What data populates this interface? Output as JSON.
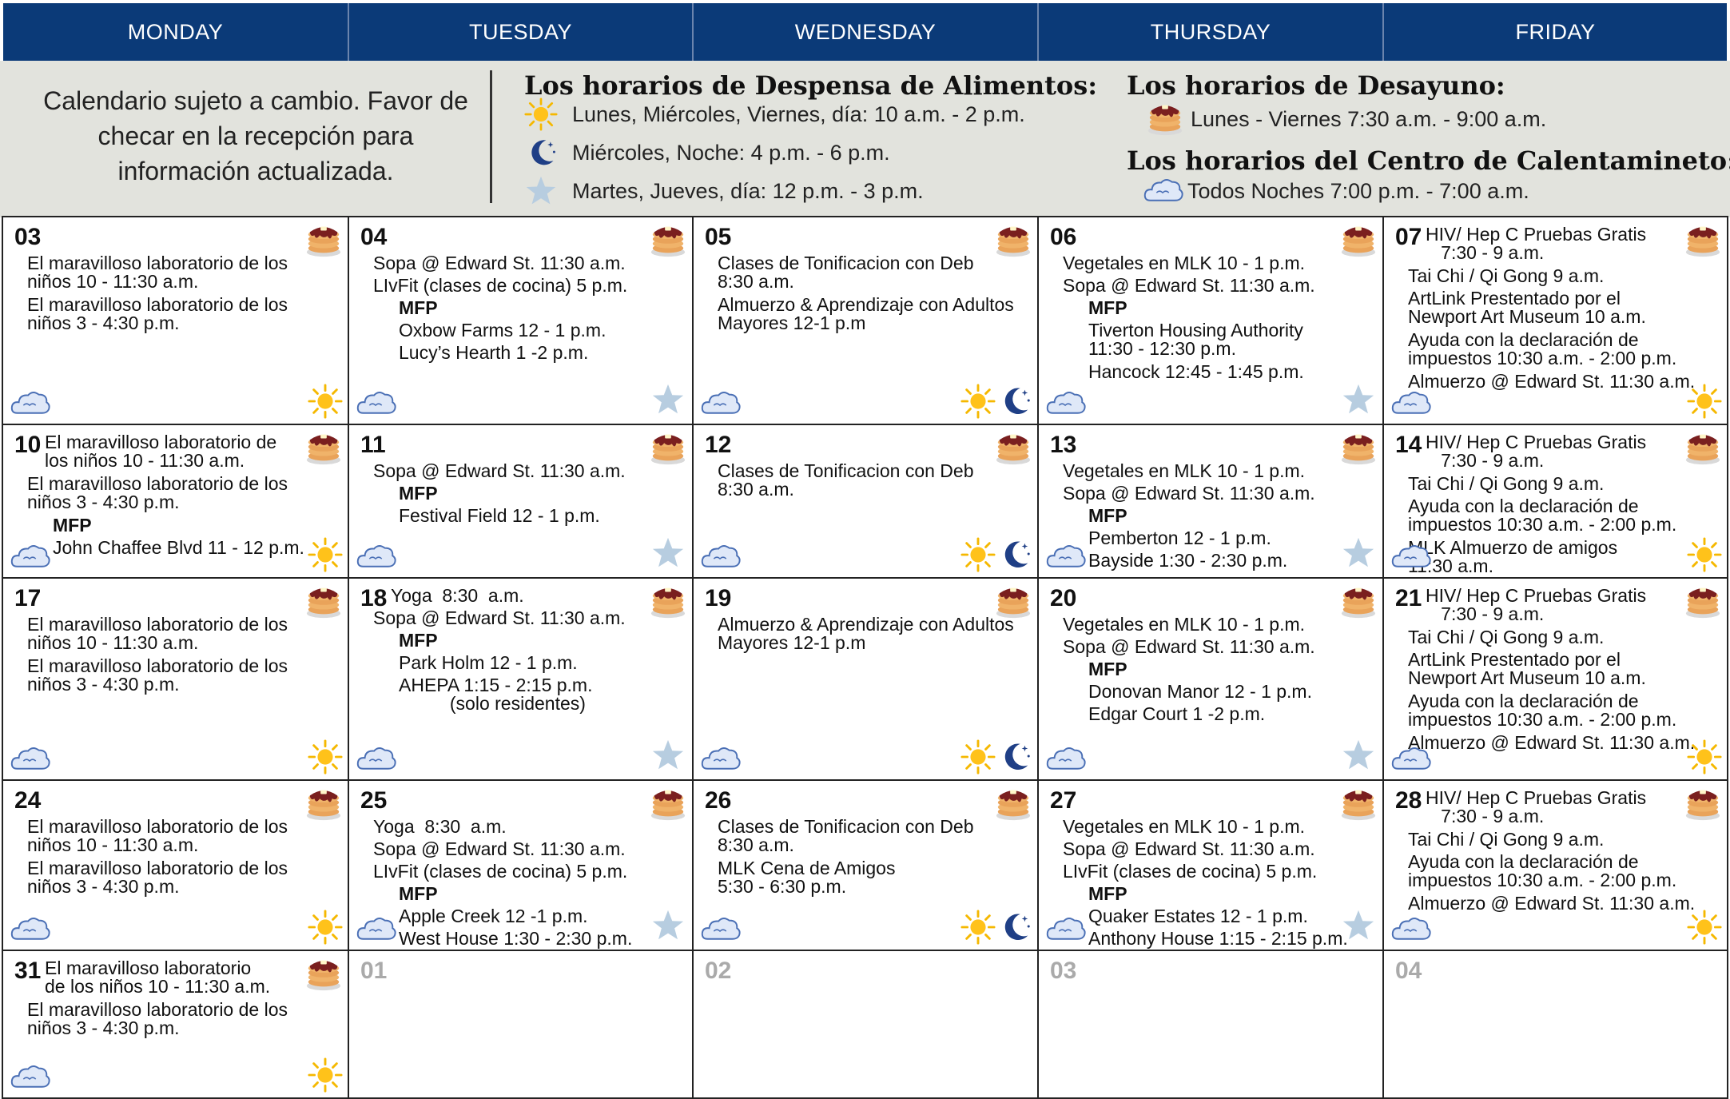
{
  "days": [
    "MONDAY",
    "TUESDAY",
    "WEDNESDAY",
    "THURSDAY",
    "FRIDAY"
  ],
  "notice": "Calendario sujeto a  cambio. Favor de checar en la recepción para información actualizada.",
  "pantry": {
    "title": "Los horarios de Despensa de Alimentos:",
    "lines": [
      {
        "icon": "sun-icon",
        "text": "Lunes, Miércoles, Viernes, día: 10 a.m. - 2 p.m."
      },
      {
        "icon": "moon-icon",
        "text": "Miércoles, Noche: 4 p.m. - 6 p.m."
      },
      {
        "icon": "star-icon",
        "text": "Martes, Jueves, día: 12 p.m. - 3 p.m."
      }
    ]
  },
  "breakfast": {
    "title": "Los horarios de Desayuno:",
    "icon": "pancake-icon",
    "text": "Lunes - Viernes 7:30 a.m. - 9:00 a.m."
  },
  "warming": {
    "title": "Los horarios del Centro de Calentamineto:",
    "icon": "cloud-icon",
    "text": "Todos Noches  7:00 p.m. - 7:00 a.m."
  },
  "cells": [
    {
      "date": "03",
      "icons": [
        "pancake",
        "cloud",
        "sun"
      ],
      "events": [
        {
          "text": "El maravilloso laboratorio de los\nniños 10 - 11:30 a.m."
        },
        {
          "text": "El maravilloso laboratorio de los\nniños 3 - 4:30 p.m."
        }
      ]
    },
    {
      "date": "04",
      "icons": [
        "pancake",
        "cloud",
        "star"
      ],
      "events": [
        {
          "text": "Sopa @ Edward St. 11:30 a.m."
        },
        {
          "text": "LIvFit (clases de cocina) 5 p.m."
        },
        {
          "text": "MFP",
          "bold": true
        },
        {
          "text": "Oxbow Farms 12 - 1 p.m."
        },
        {
          "text": "Lucy’s Hearth 1 -2 p.m."
        }
      ]
    },
    {
      "date": "05",
      "icons": [
        "pancake",
        "cloud",
        "sun",
        "moon"
      ],
      "events": [
        {
          "text": "Clases de Tonificacion con Deb\n8:30 a.m."
        },
        {
          "text": "Almuerzo & Aprendizaje con Adultos\nMayores 12-1 p.m"
        }
      ]
    },
    {
      "date": "06",
      "icons": [
        "pancake",
        "cloud",
        "star"
      ],
      "events": [
        {
          "text": "Vegetales en MLK 10 - 1 p.m."
        },
        {
          "text": "Sopa @ Edward St. 11:30 a.m."
        },
        {
          "text": "MFP",
          "bold": true
        },
        {
          "text": "Tiverton Housing Authority\n11:30 - 12:30 p.m."
        },
        {
          "text": "Hancock 12:45 - 1:45 p.m."
        }
      ]
    },
    {
      "date": "07",
      "icons": [
        "pancake",
        "cloud",
        "sun"
      ],
      "events": [
        {
          "text": "HIV/ Hep C Pruebas Gratis\n   7:30 - 9 a.m."
        },
        {
          "text": "Tai Chi / Qi Gong 9 a.m."
        },
        {
          "text": "ArtLink Prestentado por el\nNewport Art Museum 10 a.m."
        },
        {
          "text": "Ayuda con la declaración de\nimpuestos 10:30 a.m. - 2:00 p.m."
        },
        {
          "text": "Almuerzo @ Edward St. 11:30 a.m."
        }
      ]
    },
    {
      "date": "10",
      "icons": [
        "pancake",
        "cloud",
        "sun"
      ],
      "events": [
        {
          "text": "El maravilloso laboratorio de\nlos niños 10 - 11:30 a.m."
        },
        {
          "text": "El maravilloso laboratorio de los\nniños 3 - 4:30 p.m."
        },
        {
          "text": "MFP",
          "bold": true
        },
        {
          "text": "John Chaffee Blvd 11 - 12 p.m."
        }
      ]
    },
    {
      "date": "11",
      "icons": [
        "pancake",
        "cloud",
        "star"
      ],
      "events": [
        {
          "text": "Sopa @ Edward St. 11:30 a.m."
        },
        {
          "text": "MFP",
          "bold": true
        },
        {
          "text": "Festival Field 12 - 1 p.m."
        }
      ]
    },
    {
      "date": "12",
      "icons": [
        "pancake",
        "cloud",
        "sun",
        "moon"
      ],
      "events": [
        {
          "text": "Clases de Tonificacion con Deb\n8:30 a.m."
        }
      ]
    },
    {
      "date": "13",
      "icons": [
        "pancake",
        "cloud",
        "star"
      ],
      "events": [
        {
          "text": "Vegetales en MLK 10 - 1 p.m."
        },
        {
          "text": "Sopa @ Edward St. 11:30 a.m."
        },
        {
          "text": "MFP",
          "bold": true
        },
        {
          "text": "Pemberton 12 - 1 p.m."
        },
        {
          "text": "Bayside 1:30 - 2:30 p.m."
        }
      ]
    },
    {
      "date": "14",
      "icons": [
        "pancake",
        "cloud",
        "sun"
      ],
      "events": [
        {
          "text": "HIV/ Hep C Pruebas Gratis\n   7:30 - 9 a.m."
        },
        {
          "text": "Tai Chi / Qi Gong 9 a.m."
        },
        {
          "text": "Ayuda con la declaración de\nimpuestos 10:30 a.m. - 2:00 p.m."
        },
        {
          "text": "MLK Almuerzo de amigos\n11:30 a.m."
        }
      ]
    },
    {
      "date": "17",
      "icons": [
        "pancake",
        "cloud",
        "sun"
      ],
      "events": [
        {
          "text": "El maravilloso laboratorio de los\nniños 10 - 11:30 a.m."
        },
        {
          "text": "El maravilloso laboratorio de los\nniños 3 - 4:30 p.m."
        }
      ]
    },
    {
      "date": "18",
      "icons": [
        "pancake",
        "cloud",
        "star"
      ],
      "events": [
        {
          "text": "Yoga  8:30  a.m."
        },
        {
          "text": "Sopa @ Edward St. 11:30 a.m."
        },
        {
          "text": "MFP",
          "bold": true
        },
        {
          "text": "Park Holm 12 - 1 p.m."
        },
        {
          "text": "AHEPA 1:15 - 2:15 p.m.\n          (solo residentes)"
        }
      ]
    },
    {
      "date": "19",
      "icons": [
        "pancake",
        "cloud",
        "sun",
        "moon"
      ],
      "events": [
        {
          "text": "Almuerzo & Aprendizaje con Adultos\nMayores 12-1 p.m"
        }
      ]
    },
    {
      "date": "20",
      "icons": [
        "pancake",
        "cloud",
        "star"
      ],
      "events": [
        {
          "text": "Vegetales en MLK 10 - 1 p.m."
        },
        {
          "text": "Sopa @ Edward St. 11:30 a.m."
        },
        {
          "text": "MFP",
          "bold": true
        },
        {
          "text": "Donovan Manor 12 - 1 p.m."
        },
        {
          "text": "Edgar Court 1 -2 p.m."
        }
      ]
    },
    {
      "date": "21",
      "icons": [
        "pancake",
        "cloud",
        "sun"
      ],
      "events": [
        {
          "text": "HIV/ Hep C Pruebas Gratis\n   7:30 - 9 a.m."
        },
        {
          "text": "Tai Chi / Qi Gong 9 a.m."
        },
        {
          "text": "ArtLink Prestentado por el\nNewport Art Museum 10 a.m."
        },
        {
          "text": "Ayuda con la declaración de\nimpuestos 10:30 a.m. - 2:00 p.m."
        },
        {
          "text": "Almuerzo @ Edward St. 11:30 a.m."
        }
      ]
    },
    {
      "date": "24",
      "icons": [
        "pancake",
        "cloud",
        "sun"
      ],
      "events": [
        {
          "text": "El maravilloso laboratorio de los\nniños 10 - 11:30 a.m."
        },
        {
          "text": "El maravilloso laboratorio de los\nniños 3 - 4:30 p.m."
        }
      ]
    },
    {
      "date": "25",
      "icons": [
        "pancake",
        "cloud",
        "star"
      ],
      "events": [
        {
          "text": "Yoga  8:30  a.m."
        },
        {
          "text": "Sopa @ Edward St. 11:30 a.m."
        },
        {
          "text": "LIvFit (clases de cocina) 5 p.m."
        },
        {
          "text": "MFP",
          "bold": true
        },
        {
          "text": "Apple Creek 12 -1 p.m."
        },
        {
          "text": "West House 1:30 - 2:30 p.m."
        }
      ]
    },
    {
      "date": "26",
      "icons": [
        "pancake",
        "cloud",
        "sun",
        "moon"
      ],
      "events": [
        {
          "text": "Clases de Tonificacion con Deb\n8:30 a.m."
        },
        {
          "text": "MLK Cena de Amigos\n5:30 - 6:30 p.m."
        }
      ]
    },
    {
      "date": "27",
      "icons": [
        "pancake",
        "cloud",
        "star"
      ],
      "events": [
        {
          "text": "Vegetales en MLK 10 - 1 p.m."
        },
        {
          "text": "Sopa @ Edward St. 11:30 a.m."
        },
        {
          "text": "LIvFit (clases de cocina) 5 p.m."
        },
        {
          "text": "MFP",
          "bold": true
        },
        {
          "text": "Quaker Estates 12 - 1 p.m."
        },
        {
          "text": "Anthony House 1:15 - 2:15 p.m."
        }
      ]
    },
    {
      "date": "28",
      "icons": [
        "pancake",
        "cloud",
        "sun"
      ],
      "events": [
        {
          "text": "HIV/ Hep C Pruebas Gratis\n   7:30 - 9 a.m."
        },
        {
          "text": "Tai Chi / Qi Gong 9 a.m."
        },
        {
          "text": "Ayuda con la declaración de\nimpuestos 10:30 a.m. - 2:00 p.m."
        },
        {
          "text": "Almuerzo @ Edward St. 11:30 a.m."
        }
      ]
    },
    {
      "date": "31",
      "icons": [
        "pancake",
        "cloud",
        "sun"
      ],
      "events": [
        {
          "text": "El maravilloso laboratorio\nde los niños 10 - 11:30 a.m."
        },
        {
          "text": "El maravilloso laboratorio de los\nniños 3 - 4:30 p.m."
        }
      ]
    },
    {
      "date": "01",
      "muted": true,
      "icons": [],
      "events": []
    },
    {
      "date": "02",
      "muted": true,
      "icons": [],
      "events": []
    },
    {
      "date": "03",
      "muted": true,
      "icons": [],
      "events": []
    },
    {
      "date": "04",
      "muted": true,
      "icons": [],
      "events": []
    }
  ]
}
